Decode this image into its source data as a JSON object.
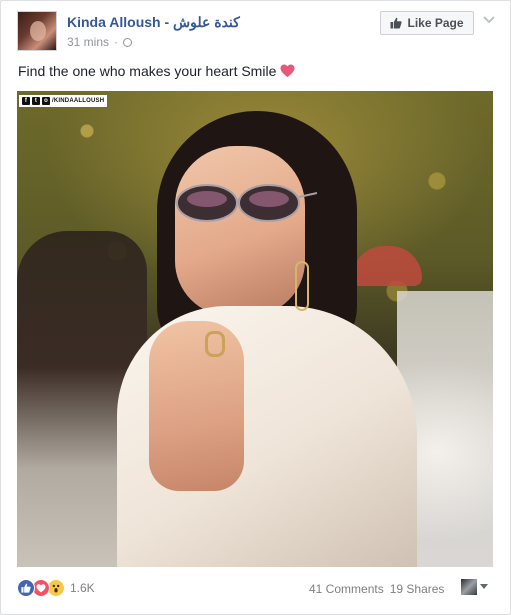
{
  "post": {
    "page_name": "Kinda Alloush - كندة علوش",
    "timestamp": "31 mins",
    "audience_icon": "globe-icon",
    "like_page_label": "Like Page",
    "caption": "Find the one who makes your heart Smile",
    "caption_emoji": "pink-heart-emoji",
    "watermark_text": "/KINDAALLOUSH"
  },
  "engagement": {
    "reaction_icons": [
      "like-icon",
      "love-icon",
      "wow-icon"
    ],
    "reaction_count": "1.6K",
    "comments": "41 Comments",
    "shares": "19 Shares"
  },
  "colors": {
    "link_blue": "#365899",
    "like_blue": "#4267b2",
    "heart_pink": "#f25268",
    "muted_text": "#90949c"
  }
}
